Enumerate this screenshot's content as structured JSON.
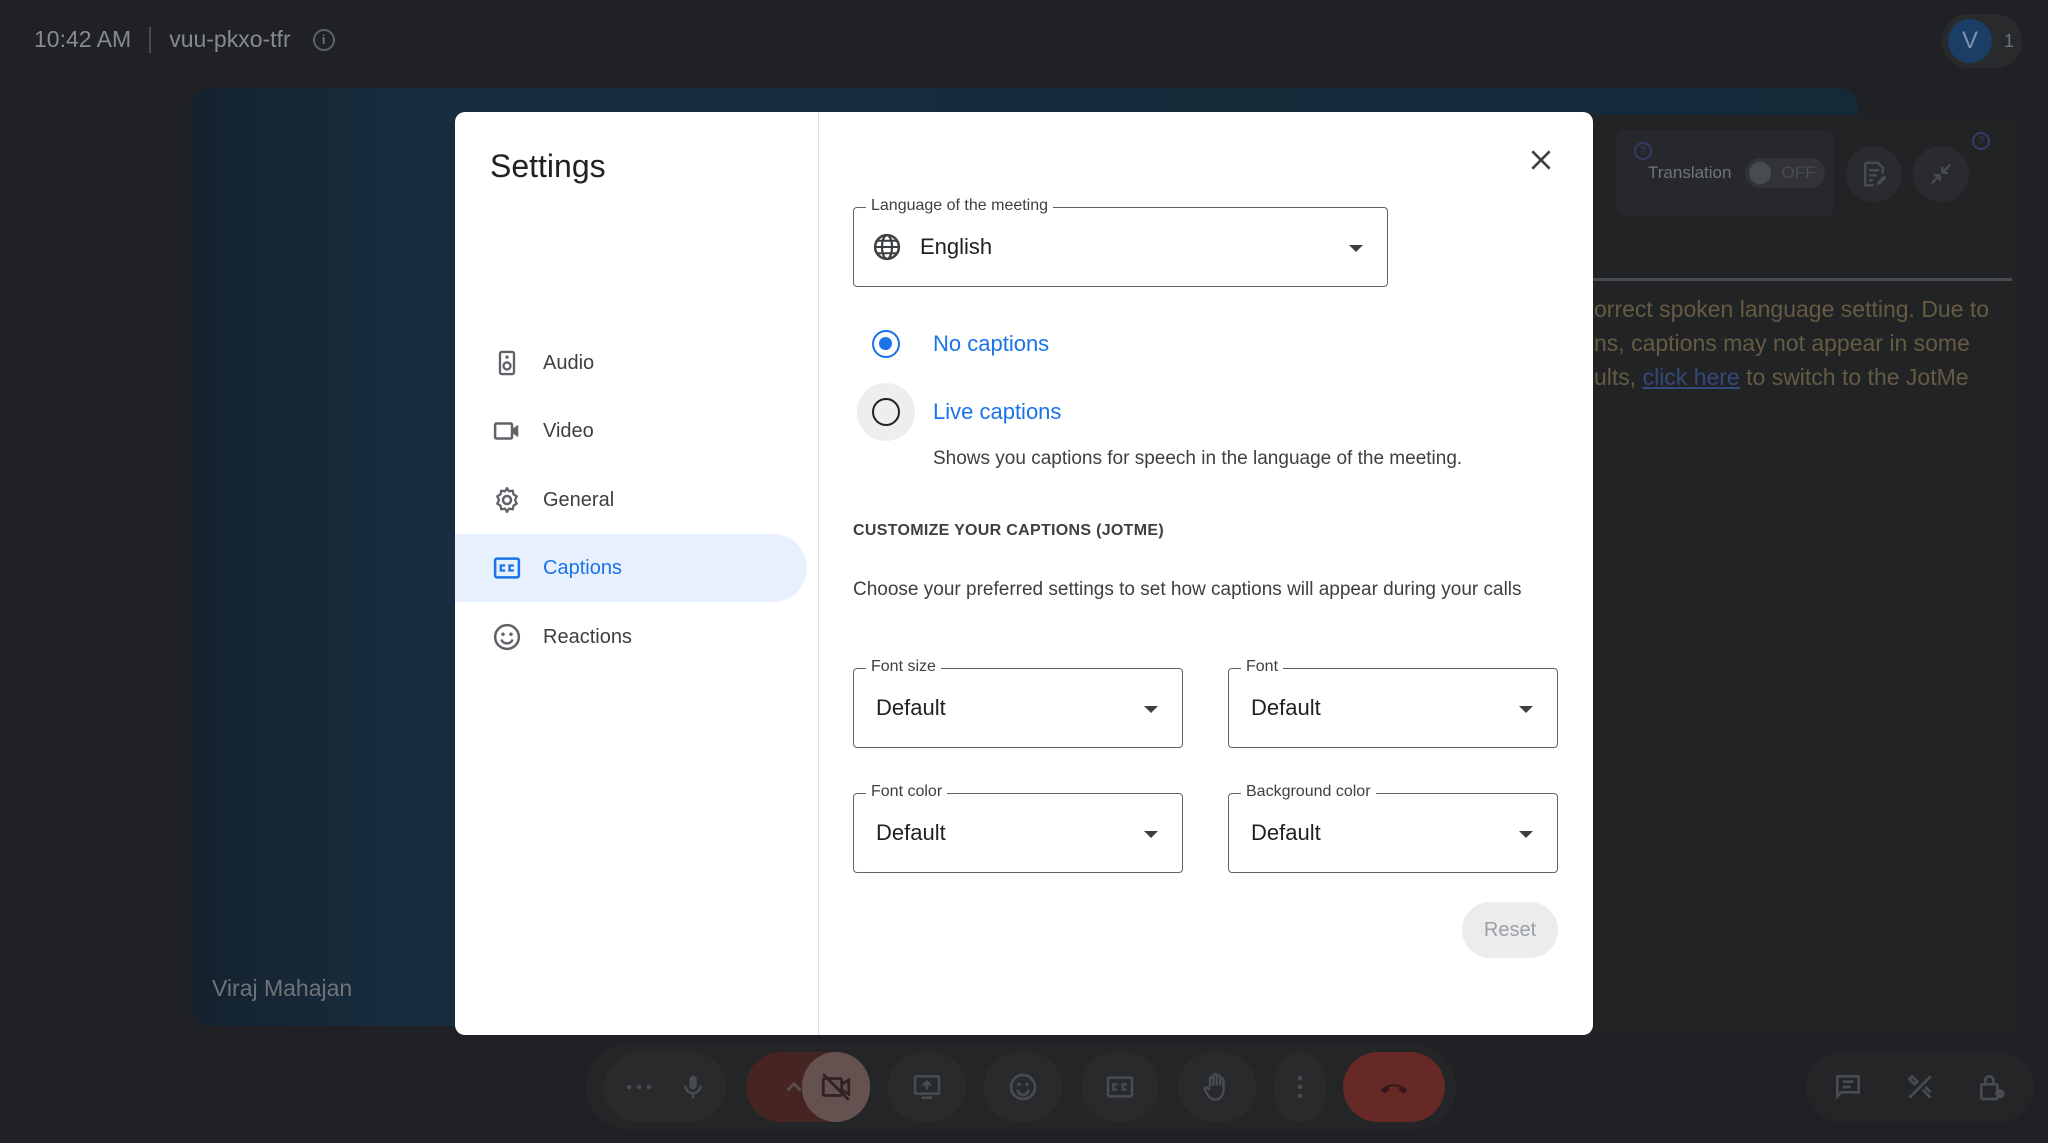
{
  "topbar": {
    "time": "10:42 AM",
    "meeting_code": "vuu-pkxo-tfr",
    "info_glyph": "i"
  },
  "participants": {
    "avatar_letter": "V",
    "count": "1"
  },
  "tile": {
    "name": "Viraj Mahajan"
  },
  "caption_panel": {
    "translation_label": "Translation",
    "translation_state": "OFF",
    "help_glyph": "?",
    "text_before_link": "orrect spoken language setting. Due to ns, captions may not appear in some ults, ",
    "link_text": "click here",
    "text_after_link": " to switch to the JotMe"
  },
  "settings": {
    "title": "Settings",
    "nav": [
      {
        "label": "Audio",
        "icon": "speaker-icon"
      },
      {
        "label": "Video",
        "icon": "video-camera-icon"
      },
      {
        "label": "General",
        "icon": "gear-icon"
      },
      {
        "label": "Captions",
        "icon": "closed-captions-icon",
        "active": true
      },
      {
        "label": "Reactions",
        "icon": "smiley-icon"
      }
    ],
    "language": {
      "legend": "Language of the meeting",
      "value": "English"
    },
    "captions_options": [
      {
        "label": "No captions",
        "checked": true
      },
      {
        "label": "Live captions",
        "checked": false
      }
    ],
    "live_captions_desc": "Shows you captions for speech in the language of the meeting.",
    "customize_heading": "CUSTOMIZE YOUR CAPTIONS (JOTME)",
    "customize_desc": "Choose your preferred settings to set how captions will appear during your calls",
    "font_size": {
      "legend": "Font size",
      "value": "Default"
    },
    "font": {
      "legend": "Font",
      "value": "Default"
    },
    "font_color": {
      "legend": "Font color",
      "value": "Default"
    },
    "background_color": {
      "legend": "Background color",
      "value": "Default"
    },
    "reset_label": "Reset"
  },
  "colors": {
    "accent": "#1a73e8",
    "active_bg": "#e8f0fe",
    "end_call": "#8c2d25"
  }
}
